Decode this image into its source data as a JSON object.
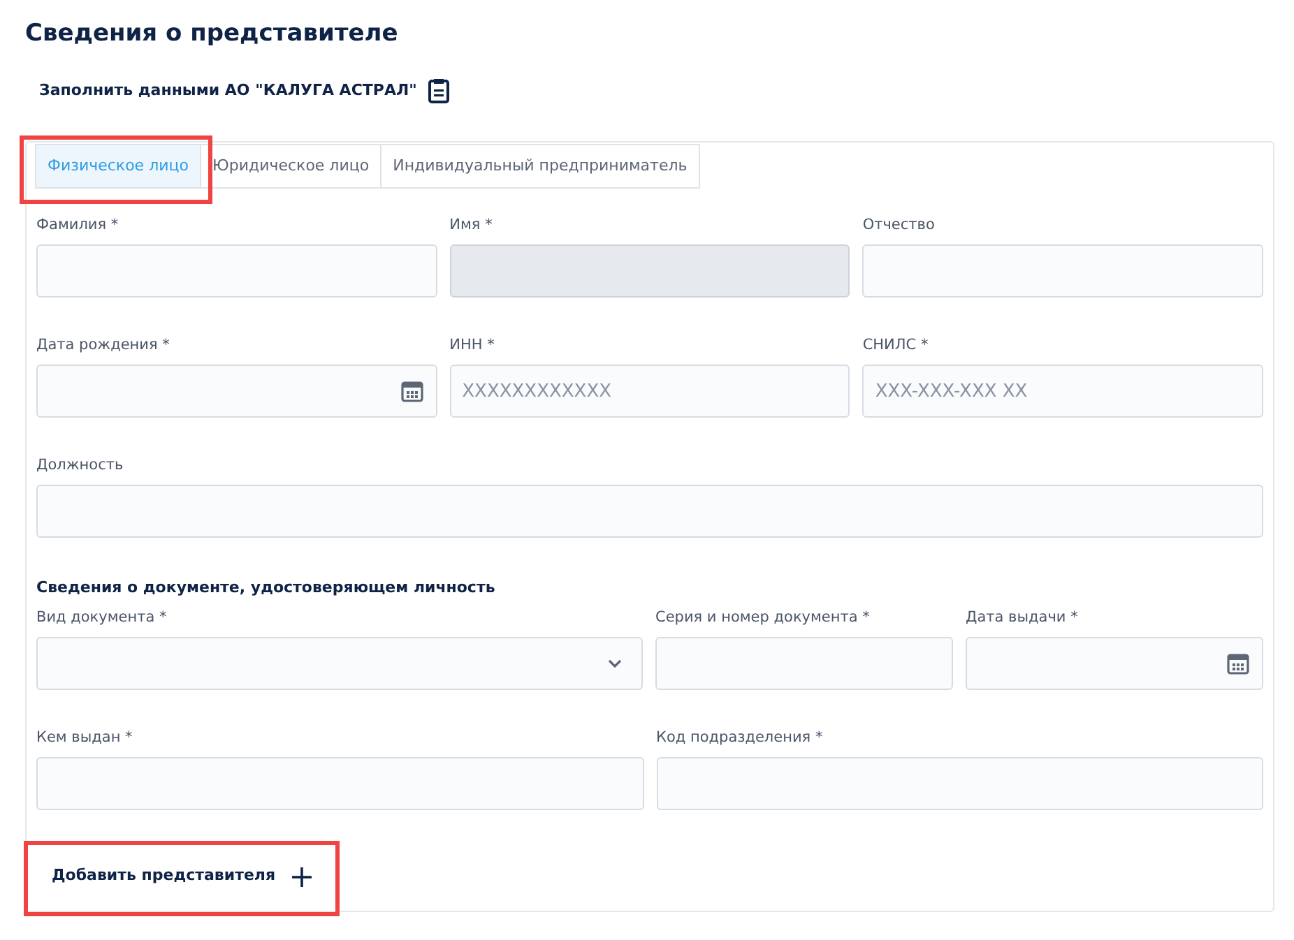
{
  "title": "Сведения о представителе",
  "fill_link": {
    "label": "Заполнить данными АО \"КАЛУГА АСТРАЛ\""
  },
  "tabs": [
    {
      "label": "Физическое лицо",
      "selected": true,
      "highlighted": true
    },
    {
      "label": "Юридическое лицо",
      "selected": false,
      "highlighted": false
    },
    {
      "label": "Индивидуальный предприниматель",
      "selected": false,
      "highlighted": false
    }
  ],
  "rows": [
    {
      "fields": [
        {
          "label": "Фамилия *",
          "kind": "text",
          "disabled": false
        },
        {
          "label": "Имя *",
          "kind": "text",
          "disabled": true
        },
        {
          "label": "Отчество",
          "kind": "text",
          "disabled": false
        }
      ]
    },
    {
      "fields": [
        {
          "label": "Дата рождения *",
          "kind": "date",
          "disabled": false
        },
        {
          "label": "ИНН *",
          "kind": "text",
          "disabled": false,
          "placeholder": "XXXXXXXXXXXX"
        },
        {
          "label": "СНИЛС *",
          "kind": "text",
          "disabled": false,
          "placeholder": "XXX-XXX-XXX XX"
        }
      ]
    },
    {
      "fields": [
        {
          "label": "Должность",
          "kind": "text",
          "disabled": false
        }
      ]
    }
  ],
  "document_section": {
    "heading": "Сведения о документе, удостоверяющем личность",
    "rows": [
      {
        "fields": [
          {
            "label": "Вид документа *",
            "kind": "select",
            "disabled": false
          },
          {
            "label": "Серия и номер документа *",
            "kind": "text",
            "disabled": false
          },
          {
            "label": "Дата выдачи *",
            "kind": "date",
            "disabled": false
          }
        ]
      },
      {
        "fields": [
          {
            "label": "Кем выдан *",
            "kind": "text",
            "disabled": false
          },
          {
            "label": "Код подразделения *",
            "kind": "text",
            "disabled": false
          }
        ]
      }
    ]
  },
  "add_button": {
    "label": "Добавить представителя",
    "highlighted": true
  }
}
